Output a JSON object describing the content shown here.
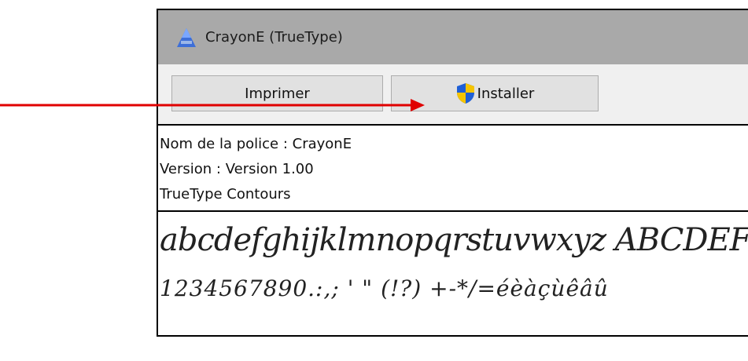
{
  "window": {
    "title": "CrayonE (TrueType)",
    "app_icon": "font-app-icon"
  },
  "toolbar": {
    "print_label": "Imprimer",
    "install_label": "Installer",
    "install_icon": "uac-shield-icon"
  },
  "info": {
    "font_name": "Nom de la police : CrayonE",
    "version": "Version : Version 1.00",
    "type": "TrueType  Contours"
  },
  "sample": {
    "line1": "abcdefghijklmnopqrstuvwxyz ABCDEFGHI",
    "line2": "1234567890.:,;  ' \"  (!?)  +-*/=éèàçùêâû"
  },
  "colors": {
    "arrow": "#e00000",
    "titlebar": "#a9a9a9",
    "toolbar": "#f0f0f0",
    "button": "#e1e1e1"
  }
}
